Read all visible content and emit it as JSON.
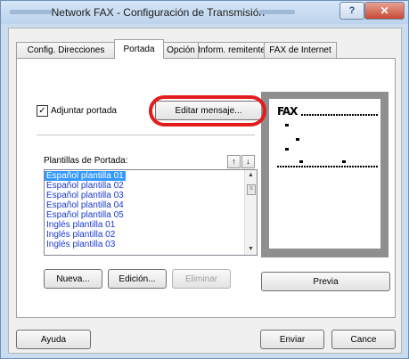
{
  "window": {
    "title": "Network FAX - Configuración de Transmisión -",
    "help_label": "?",
    "close_label": "✕"
  },
  "tabs": [
    {
      "label": "Config. Direcciones"
    },
    {
      "label": "Portada"
    },
    {
      "label": "Opción"
    },
    {
      "label": "Inform. remitente"
    },
    {
      "label": "FAX de Internet"
    }
  ],
  "cover": {
    "attach_label": "Adjuntar portada",
    "attach_checked": "✓",
    "edit_message_label": "Editar mensaje...",
    "templates_label": "Plantillas de Portada:",
    "templates": [
      "Español plantilla 01",
      "Español plantilla 02",
      "Español plantilla 03",
      "Español plantilla 04",
      "Español plantilla 05",
      "Inglés plantilla 01",
      "Inglés plantilla 02",
      "Inglés plantilla 03"
    ],
    "move_up": "↑",
    "move_down": "↓",
    "new_label": "Nueva...",
    "edit_label": "Edición...",
    "delete_label": "Eliminar",
    "preview_button": "Previa",
    "preview_fax_text": "FAX"
  },
  "footer": {
    "help_label": "Ayuda",
    "send_label": "Enviar",
    "cancel_label": "Cance"
  },
  "colors": {
    "highlight": "#e31b1b",
    "selection": "#3399ff",
    "list_text": "#1a3bcc"
  }
}
